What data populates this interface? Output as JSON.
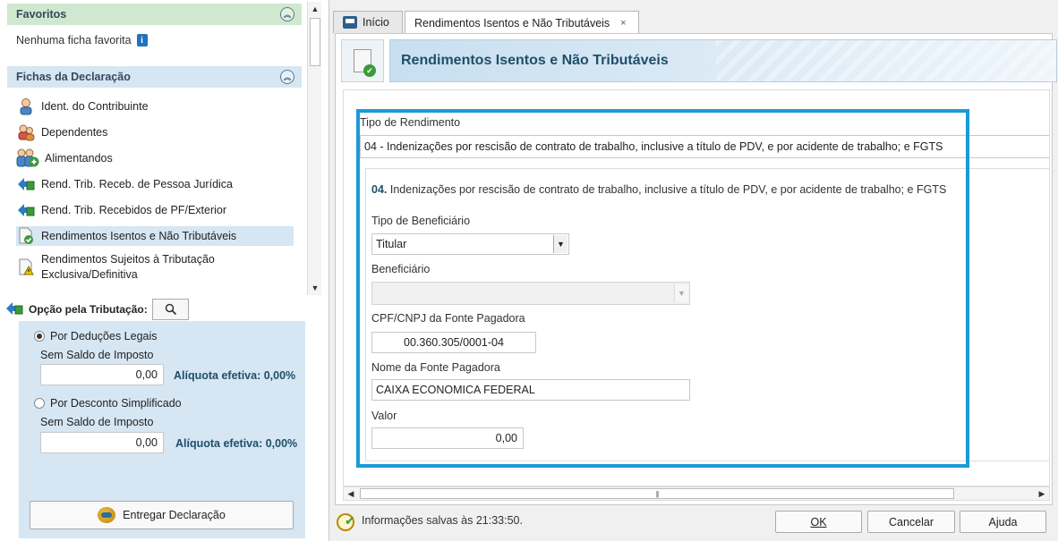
{
  "sidebar": {
    "favorites": {
      "title": "Favoritos",
      "empty_text": "Nenhuma ficha favorita"
    },
    "forms": {
      "title": "Fichas da Declaração",
      "items": [
        {
          "label": "Ident. do Contribuinte",
          "icon": "person-icon"
        },
        {
          "label": "Dependentes",
          "icon": "people-icon"
        },
        {
          "label": "Alimentandos",
          "icon": "people-add-icon"
        },
        {
          "label": "Rend. Trib. Receb. de Pessoa Jurídica",
          "icon": "arrow-money-icon"
        },
        {
          "label": "Rend. Trib. Recebidos de PF/Exterior",
          "icon": "arrow-money-icon"
        },
        {
          "label": "Rendimentos Isentos e Não Tributáveis",
          "icon": "doc-check-icon"
        },
        {
          "label": "Rendimentos Sujeitos à Tributação Exclusiva/Definitiva",
          "icon": "doc-warning-icon"
        }
      ]
    },
    "taxation": {
      "label": "Opção pela Tributação:",
      "options": [
        {
          "label": "Por Deduções Legais",
          "selected": true,
          "sub_label": "Sem Saldo de Imposto",
          "value": "0,00",
          "rate": "Alíquota efetiva: 0,00%"
        },
        {
          "label": "Por Desconto Simplificado",
          "selected": false,
          "sub_label": "Sem Saldo de Imposto",
          "value": "0,00",
          "rate": "Alíquota efetiva: 0,00%"
        }
      ],
      "deliver_button": "Entregar Declaração"
    }
  },
  "tabs": [
    {
      "label": "Início",
      "icon": "home-icon",
      "active": false
    },
    {
      "label": "Rendimentos Isentos e Não Tributáveis",
      "close": "×",
      "active": true
    }
  ],
  "form": {
    "title": "Rendimentos Isentos e Não Tributáveis",
    "income_type_label": "Tipo de Rendimento",
    "income_type_value": "04 - Indenizações por rescisão de contrato de trabalho, inclusive a título de PDV, e por acidente de trabalho; e FGTS",
    "section_number": "04.",
    "section_title": "Indenizações por rescisão de contrato de trabalho, inclusive a título de PDV, e por acidente de trabalho; e FGTS",
    "beneficiary_type_label": "Tipo de Beneficiário",
    "beneficiary_type_value": "Titular",
    "beneficiary_label": "Beneficiário",
    "beneficiary_value": "",
    "cnpj_label": "CPF/CNPJ da Fonte Pagadora",
    "cnpj_value": "00.360.305/0001-04",
    "payer_name_label": "Nome da Fonte Pagadora",
    "payer_name_value": "CAIXA ECONOMICA FEDERAL",
    "amount_label": "Valor",
    "amount_value": "0,00",
    "highlight_color": "#1a9bd6"
  },
  "status": {
    "saved_text": "Informações salvas às 21:33:50."
  },
  "buttons": {
    "ok": "OK",
    "cancel": "Cancelar",
    "help": "Ajuda"
  }
}
